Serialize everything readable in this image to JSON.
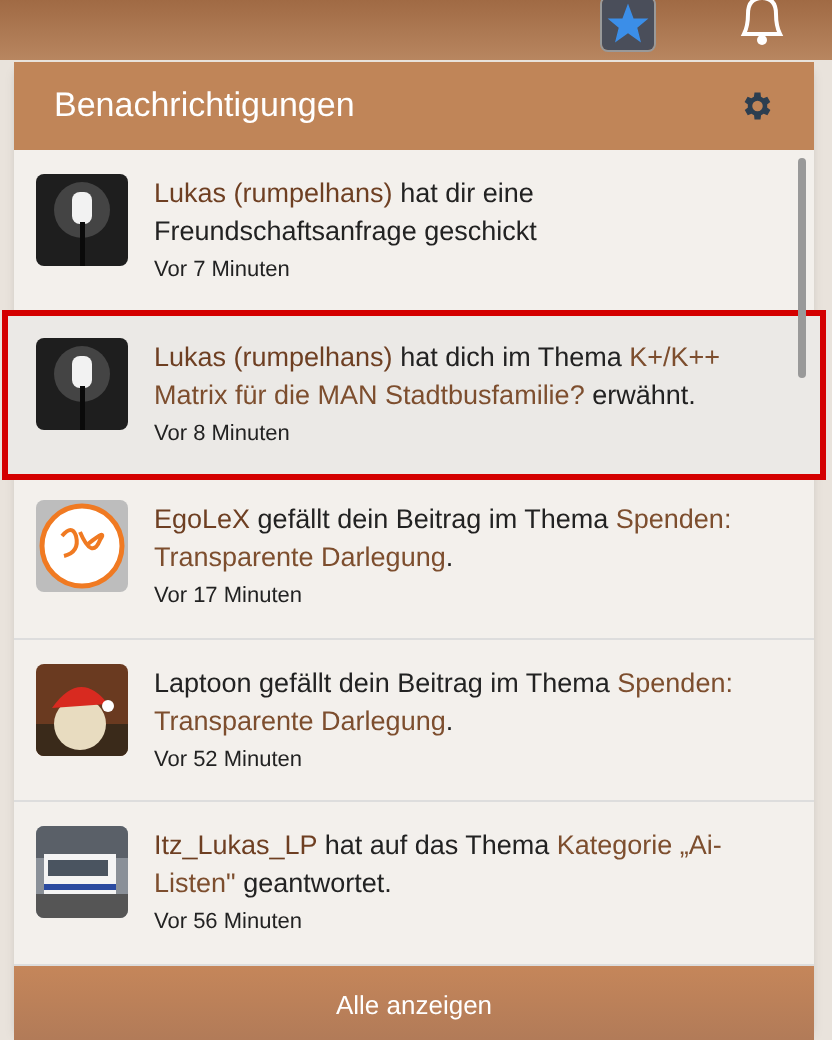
{
  "panel": {
    "title": "Benachrichtigungen",
    "footer": "Alle anzeigen"
  },
  "notifications": [
    {
      "avatar": {
        "kind": "picture"
      },
      "highlighted": false,
      "parts": [
        {
          "kind": "user",
          "text": "Lukas (rumpelhans)"
        },
        {
          "kind": "text",
          "text": " hat dir eine Freundschaftsanfrage geschickt"
        }
      ],
      "time": "Vor 7 Minuten"
    },
    {
      "avatar": {
        "kind": "picture"
      },
      "highlighted": true,
      "parts": [
        {
          "kind": "user",
          "text": "Lukas (rumpelhans)"
        },
        {
          "kind": "text",
          "text": " hat dich im Thema "
        },
        {
          "kind": "link",
          "text": "K+/K++ Matrix für die MAN Stadtbusfamilie?"
        },
        {
          "kind": "text",
          "text": " erwähnt."
        }
      ],
      "time": "Vor 8 Minuten"
    },
    {
      "avatar": {
        "kind": "picture"
      },
      "highlighted": false,
      "parts": [
        {
          "kind": "user",
          "text": "EgoLeX"
        },
        {
          "kind": "text",
          "text": " gefällt dein Beitrag im Thema "
        },
        {
          "kind": "link",
          "text": "Spenden: Transparente Darlegung"
        },
        {
          "kind": "text",
          "text": "."
        }
      ],
      "time": "Vor 17 Minuten"
    },
    {
      "avatar": {
        "kind": "picture"
      },
      "highlighted": false,
      "parts": [
        {
          "kind": "text",
          "text": "Laptoon gefällt dein Beitrag im Thema "
        },
        {
          "kind": "link",
          "text": "Spenden: Transparente Darlegung"
        },
        {
          "kind": "text",
          "text": "."
        }
      ],
      "time": "Vor 52 Minuten"
    },
    {
      "avatar": {
        "kind": "picture"
      },
      "highlighted": false,
      "parts": [
        {
          "kind": "user",
          "text": "Itz_Lukas_LP"
        },
        {
          "kind": "text",
          "text": " hat auf das Thema "
        },
        {
          "kind": "link",
          "text": "Kategorie „Ai-Listen\""
        },
        {
          "kind": "text",
          "text": " geantwortet."
        }
      ],
      "time": "Vor 56 Minuten"
    }
  ]
}
